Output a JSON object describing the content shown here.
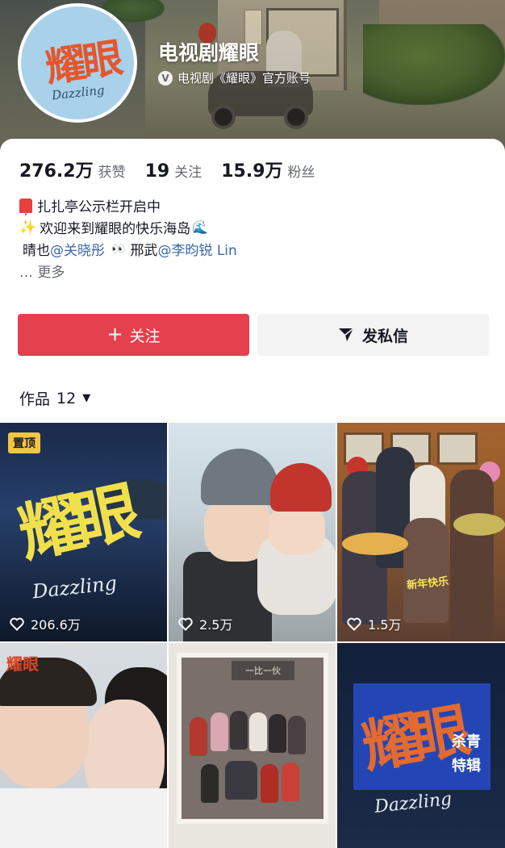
{
  "profile": {
    "name": "电视剧耀眼",
    "verified_text": "电视剧《耀眼》官方账号",
    "avatar_title": "耀眼",
    "avatar_subtitle": "Dazzling"
  },
  "stats": [
    {
      "num": "276.2万",
      "label": "获赞"
    },
    {
      "num": "19",
      "label": "关注"
    },
    {
      "num": "15.9万",
      "label": "粉丝"
    }
  ],
  "bio": {
    "line1": "扎扎亭公示栏开启中",
    "line2": "欢迎来到耀眼的快乐海岛",
    "line3_a": "晴也 ",
    "line3_mention1": "@关晓彤",
    "line3_b": "邢武 ",
    "line3_mention2": "@李昀锐 Lin",
    "more": "… 更多"
  },
  "actions": {
    "follow_label": "关注",
    "message_label": "发私信"
  },
  "works": {
    "tab_label": "作品",
    "count": "12"
  },
  "videos": [
    {
      "likes": "206.6万",
      "pinned_label": "置顶",
      "logo": "耀眼",
      "subtitle": "Dazzling"
    },
    {
      "likes": "2.5万"
    },
    {
      "likes": "1.5万",
      "banner": "新年快乐"
    },
    {
      "mark": "耀眼"
    },
    {
      "signboard": "一比一伙"
    },
    {
      "logo": "耀眼",
      "badge_line1": "杀青",
      "badge_line2": "特辑",
      "subtitle": "Dazzling"
    }
  ],
  "colors": {
    "follow_button": "#e4404d",
    "message_button": "#f3f3f4",
    "mention": "#3a67a8",
    "pinned_badge": "#f4c542"
  },
  "icons": [
    "verified-icon",
    "mailbox-icon",
    "sparkle-icon",
    "wave-icon",
    "eyes-icon",
    "plus-icon",
    "send-icon",
    "caret-down-icon",
    "heart-icon"
  ]
}
